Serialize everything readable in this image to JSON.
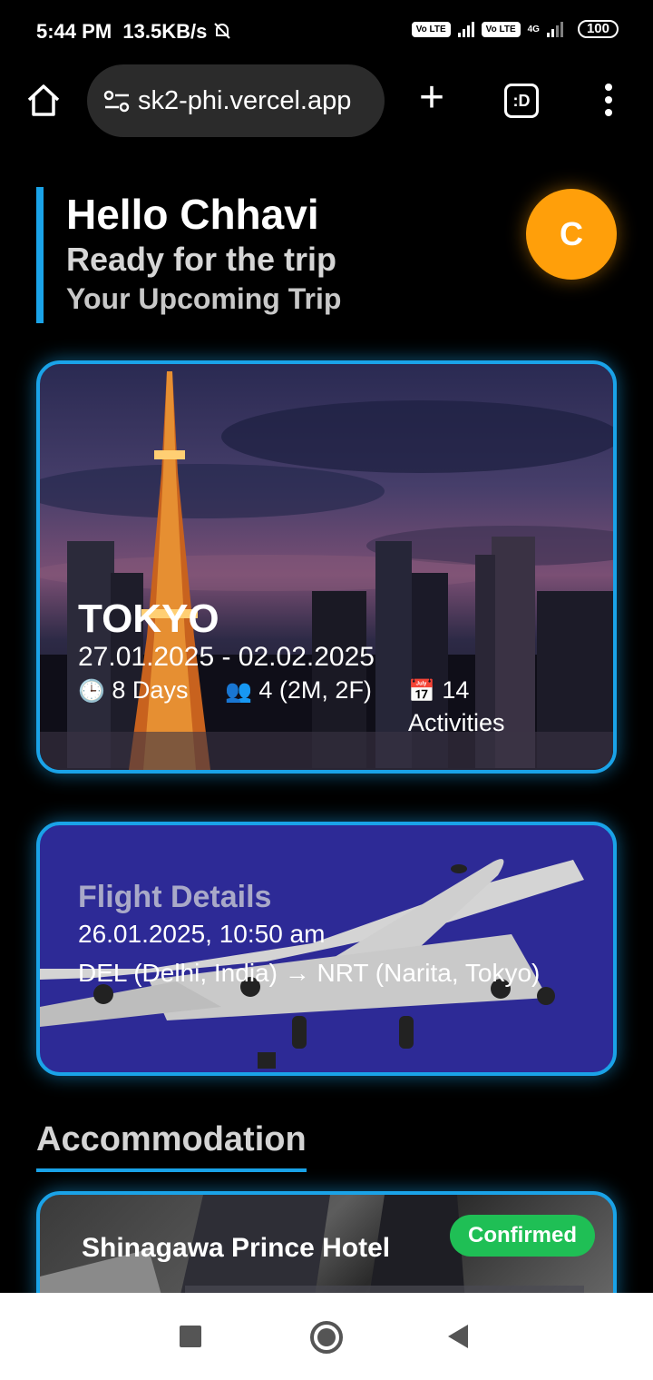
{
  "status_bar": {
    "time": "5:44 PM",
    "net_speed": "13.5KB/s",
    "volte_1": "Vo LTE",
    "volte_2": "Vo LTE",
    "net_type": "4G",
    "battery": "100"
  },
  "browser": {
    "url": "sk2-phi.vercel.app",
    "tab_label": ":D"
  },
  "greeting": {
    "hello": "Hello Chhavi",
    "subtitle": "Ready for the trip",
    "section": "Your Upcoming Trip"
  },
  "avatar": {
    "initial": "C",
    "color": "#ff9f0a"
  },
  "trip": {
    "city": "TOKYO",
    "dates": "27.01.2025 - 02.02.2025",
    "duration_icon": "🕒",
    "duration": "8 Days",
    "travelers_icon": "👥",
    "travelers": "4 (2M, 2F)",
    "activities_icon": "📅",
    "activities": "14 Activities"
  },
  "flight": {
    "title": "Flight Details",
    "datetime": "26.01.2025, 10:50 am",
    "route": "DEL (Delhi, India) → NRT (Narita, Tokyo)"
  },
  "accommodation": {
    "section_title": "Accommodation",
    "hotel_name": "Shinagawa Prince Hotel",
    "status": "Confirmed",
    "status_color": "#1fbf55"
  },
  "theme": {
    "accent": "#1aa3e8",
    "flight_bg": "#2d2a96"
  }
}
